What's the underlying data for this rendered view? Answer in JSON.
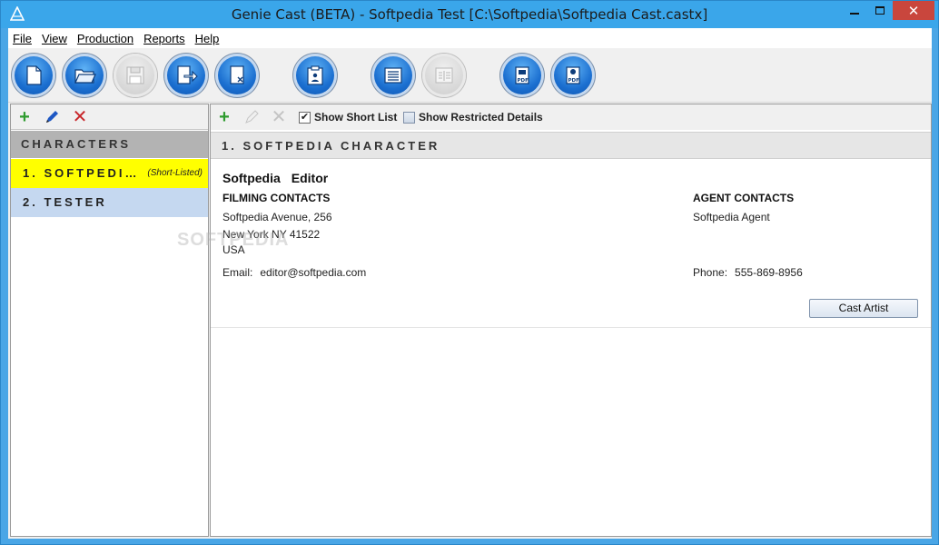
{
  "window": {
    "title": "Genie Cast (BETA) - Softpedia Test [C:\\Softpedia\\Softpedia Cast.castx]",
    "close_glyph": "✕"
  },
  "menu": [
    {
      "label": "File"
    },
    {
      "label": "View"
    },
    {
      "label": "Production"
    },
    {
      "label": "Reports"
    },
    {
      "label": "Help"
    }
  ],
  "toolbar": {
    "buttons": [
      {
        "icon": "new-document-icon",
        "enabled": true
      },
      {
        "icon": "open-folder-icon",
        "enabled": true
      },
      {
        "icon": "save-disk-icon",
        "enabled": false
      },
      {
        "icon": "export-icon",
        "enabled": true
      },
      {
        "icon": "close-document-icon",
        "enabled": true
      },
      {
        "icon": "clipboard-person-icon",
        "enabled": true
      },
      {
        "icon": "list-view-icon",
        "enabled": true
      },
      {
        "icon": "detail-view-icon",
        "enabled": false
      },
      {
        "icon": "pdf-report-icon",
        "enabled": true
      },
      {
        "icon": "pdf-cast-report-icon",
        "enabled": true
      }
    ]
  },
  "characters_panel": {
    "header": "CHARACTERS",
    "items": [
      {
        "label": "1. SOFTPEDI…",
        "tag": "(Short-Listed)",
        "selected": true
      },
      {
        "label": "2. TESTER",
        "tag": "",
        "selected": false
      }
    ]
  },
  "detail_toolbar": {
    "show_short_list": {
      "label": "Show Short List",
      "checked": true
    },
    "show_restricted": {
      "label": "Show Restricted Details",
      "checked": false
    }
  },
  "detail": {
    "header": "1. SOFTPEDIA CHARACTER",
    "first_name": "Softpedia",
    "last_name": "Editor",
    "filming": {
      "title": "FILMING CONTACTS",
      "address1": "Softpedia Avenue, 256",
      "address2": "New York NY 41522",
      "country": "USA",
      "email_label": "Email:",
      "email": "editor@softpedia.com"
    },
    "agent": {
      "title": "AGENT CONTACTS",
      "name": "Softpedia Agent",
      "phone_label": "Phone:",
      "phone": "555-869-8956"
    },
    "cast_button": "Cast Artist"
  },
  "watermark": "SOFTPEDIA"
}
